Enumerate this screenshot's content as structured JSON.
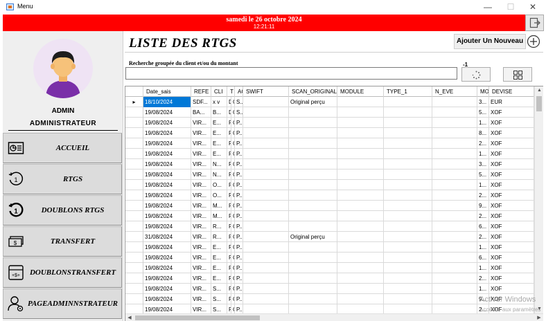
{
  "window": {
    "title": "Menu",
    "minimize": "—",
    "maximize": "☐",
    "close": "✕"
  },
  "header": {
    "date": "samedi le 26 octobre 2024",
    "time": "12:21:11",
    "bar_color": "#ff0000"
  },
  "user": {
    "name": "ADMIN",
    "role": "ADMINISTRATEUR"
  },
  "nav": {
    "accueil": "ACCUEIL",
    "rtgs": "RTGS",
    "doublons_rtgs": "DOUBLONS RTGS",
    "transfert": "TRANSFERT",
    "doublons_transfert_1": "DOUBLONS",
    "doublons_transfert_2": "TRANSFERT",
    "page_admin_1": "PAGE",
    "page_admin_2": "ADMINNSTRATEUR"
  },
  "main": {
    "title": "LISTE DES RTGS",
    "add_label": "Ajouter Un Nouveau",
    "search_label": "Recherche groupée du client et/ou du montant",
    "search_value": "",
    "count": "-1"
  },
  "grid": {
    "columns": [
      "Date_sais",
      "REFE",
      "CLI",
      "T",
      "AC",
      "SWIFT",
      "SCAN_ORIGINAL",
      "MODULE",
      "TYPE_1",
      "N_EVE",
      "MO",
      "DEVISE"
    ],
    "rows": [
      [
        "18/10/2024",
        "SDF...",
        "x v",
        "D",
        "C..",
        "S...",
        "",
        "Original perçu",
        "",
        "",
        "",
        "3...",
        "EUR"
      ],
      [
        "19/08/2024",
        "BA...",
        "B...",
        "D",
        "C..",
        "S...",
        "",
        "",
        "",
        "",
        "",
        "5...",
        "XOF"
      ],
      [
        "19/08/2024",
        "VIR...",
        "E...",
        "P",
        "C..",
        "P...",
        "",
        "",
        "",
        "",
        "",
        "1...",
        "XOF"
      ],
      [
        "19/08/2024",
        "VIR...",
        "E...",
        "P",
        "C..",
        "P...",
        "",
        "",
        "",
        "",
        "",
        "8...",
        "XOF"
      ],
      [
        "19/08/2024",
        "VIR...",
        "E...",
        "P",
        "C..",
        "P...",
        "",
        "",
        "",
        "",
        "",
        "2...",
        "XOF"
      ],
      [
        "19/08/2024",
        "VIR...",
        "E...",
        "P",
        "C..",
        "P...",
        "",
        "",
        "",
        "",
        "",
        "1...",
        "XOF"
      ],
      [
        "19/08/2024",
        "VIR...",
        "N...",
        "P",
        "C..",
        "P...",
        "",
        "",
        "",
        "",
        "",
        "3...",
        "XOF"
      ],
      [
        "19/08/2024",
        "VIR...",
        "N...",
        "P",
        "C..",
        "P...",
        "",
        "",
        "",
        "",
        "",
        "5...",
        "XOF"
      ],
      [
        "19/08/2024",
        "VIR...",
        "O...",
        "P",
        "C..",
        "P...",
        "",
        "",
        "",
        "",
        "",
        "1...",
        "XOF"
      ],
      [
        "19/08/2024",
        "VIR...",
        "O...",
        "P",
        "C..",
        "P...",
        "",
        "",
        "",
        "",
        "",
        "2...",
        "XOF"
      ],
      [
        "19/08/2024",
        "VIR...",
        "M...",
        "P",
        "C..",
        "P...",
        "",
        "",
        "",
        "",
        "",
        "9...",
        "XOF"
      ],
      [
        "19/08/2024",
        "VIR...",
        "M...",
        "P",
        "C..",
        "P...",
        "",
        "",
        "",
        "",
        "",
        "2...",
        "XOF"
      ],
      [
        "19/08/2024",
        "VIR...",
        "R...",
        "P",
        "C..",
        "P...",
        "",
        "",
        "",
        "",
        "",
        "6...",
        "XOF"
      ],
      [
        "31/08/2024",
        "VIR...",
        "R...",
        "P",
        "C..",
        "P...",
        "",
        "Original perçu",
        "",
        "",
        "",
        "2...",
        "XOF"
      ],
      [
        "19/08/2024",
        "VIR...",
        "E...",
        "P",
        "C..",
        "P...",
        "",
        "",
        "",
        "",
        "",
        "1...",
        "XOF"
      ],
      [
        "19/08/2024",
        "VIR...",
        "E...",
        "P",
        "C..",
        "P...",
        "",
        "",
        "",
        "",
        "",
        "6...",
        "XOF"
      ],
      [
        "19/08/2024",
        "VIR...",
        "E...",
        "P",
        "C..",
        "P...",
        "",
        "",
        "",
        "",
        "",
        "1...",
        "XOF"
      ],
      [
        "19/08/2024",
        "VIR...",
        "E...",
        "P",
        "C..",
        "P...",
        "",
        "",
        "",
        "",
        "",
        "2...",
        "XOF"
      ],
      [
        "19/08/2024",
        "VIR...",
        "S...",
        "P",
        "C..",
        "P...",
        "",
        "",
        "",
        "",
        "",
        "1...",
        "XOF"
      ],
      [
        "19/08/2024",
        "VIR...",
        "S...",
        "P",
        "C..",
        "P...",
        "",
        "",
        "",
        "",
        "",
        "9...",
        "XOF"
      ],
      [
        "19/08/2024",
        "VIR...",
        "S...",
        "P",
        "C..",
        "P...",
        "",
        "",
        "",
        "",
        "",
        "2...",
        "XOF"
      ]
    ]
  },
  "watermark": {
    "line1": "Activer Windows",
    "line2": "Accédez aux paramètres"
  }
}
